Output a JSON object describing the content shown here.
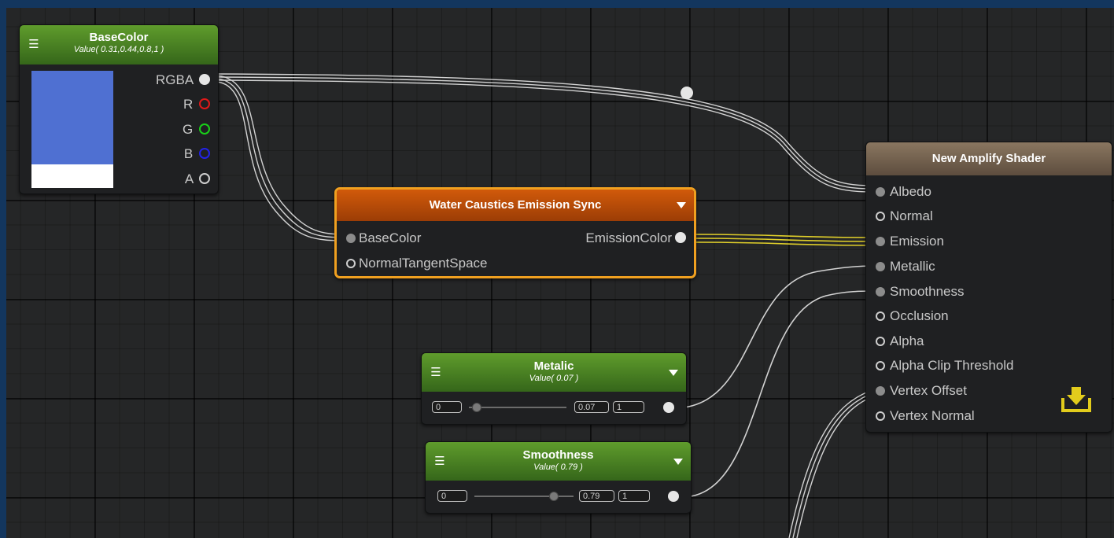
{
  "canvas": {
    "background": "#252627",
    "frame": "#13365e"
  },
  "wire_colors": {
    "default": "#d2d2d2",
    "emission": "#e0cf2a"
  },
  "base_color_node": {
    "title": "BaseColor",
    "subtitle": "Value( 0.31,0.44,0.8,1 )",
    "preview_color": "#4f70d2",
    "alpha_color": "#ffffff",
    "outputs": [
      {
        "label": "RGBA",
        "color": "#e6e6e6"
      },
      {
        "label": "R",
        "color": "#e01919"
      },
      {
        "label": "G",
        "color": "#19d019"
      },
      {
        "label": "B",
        "color": "#2323e8"
      },
      {
        "label": "A",
        "color": "#e6e6e6"
      }
    ]
  },
  "water_node": {
    "title": "Water Caustics Emission Sync",
    "inputs": [
      "BaseColor",
      "NormalTangentSpace"
    ],
    "output": "EmissionColor",
    "border_color": "#f0a020"
  },
  "metalic_node": {
    "title": "Metalic",
    "subtitle": "Value( 0.07 )",
    "min": "0",
    "value": "0.07",
    "max": "1",
    "slider_fraction": 0.07
  },
  "smoothness_node": {
    "title": "Smoothness",
    "subtitle": "Value( 0.79 )",
    "min": "0",
    "value": "0.79",
    "max": "1",
    "slider_fraction": 0.79
  },
  "output_node": {
    "title": "New Amplify Shader",
    "inputs": [
      {
        "label": "Albedo",
        "connected": true
      },
      {
        "label": "Normal",
        "connected": false
      },
      {
        "label": "Emission",
        "connected": true
      },
      {
        "label": "Metallic",
        "connected": true
      },
      {
        "label": "Smoothness",
        "connected": true
      },
      {
        "label": "Occlusion",
        "connected": false
      },
      {
        "label": "Alpha",
        "connected": false
      },
      {
        "label": "Alpha Clip Threshold",
        "connected": false
      },
      {
        "label": "Vertex Offset",
        "connected": true
      },
      {
        "label": "Vertex Normal",
        "connected": false
      }
    ],
    "action_icon": "download-icon",
    "action_color": "#e2cc1c"
  }
}
